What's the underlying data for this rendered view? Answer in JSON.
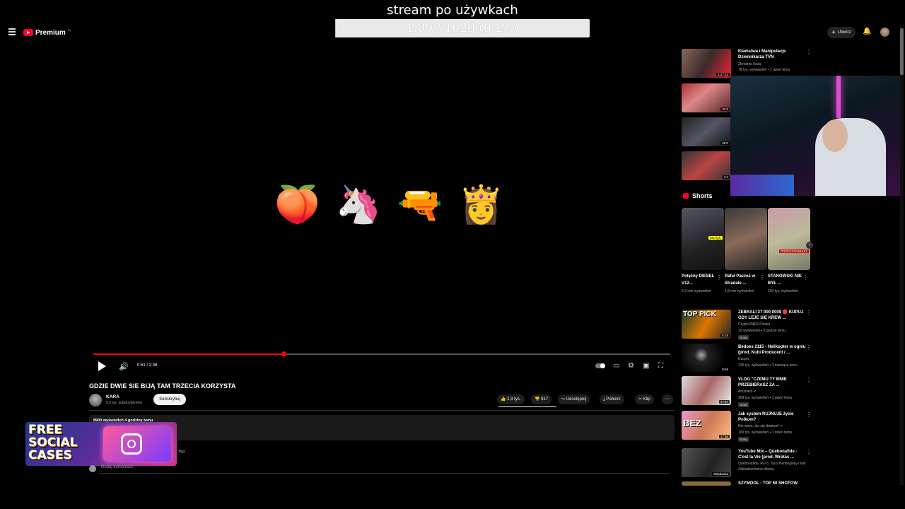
{
  "stream": {
    "title": "stream po używkach",
    "progress_text": "1.00 / 1020 (0.1%)",
    "progress_fraction": 0.001
  },
  "header": {
    "logo_text": "Premium",
    "logo_sup": "PL",
    "create_label": "Utwórz"
  },
  "player": {
    "emojis": [
      "🍑",
      "🦄",
      "🔫",
      "👸"
    ],
    "time": "0:51 / 2:36",
    "progress_fraction": 0.33
  },
  "video": {
    "title": "GDZIE DWIE SIE BIJĄ TAM TRZECIA KORZYSTA",
    "channel": "KARA",
    "subscribers": "5,5 tys. subskrybentów",
    "subscribe_label": "Subskrybuj",
    "likes": "2,3 tys.",
    "dislikes": "917",
    "share_label": "Udostępnij",
    "download_label": "Pobierz",
    "clip_label": "Klip",
    "description_meta": "8900 wyświetleń  4 godziny temu",
    "add_comment": "Dodaj komentarz",
    "partial_label": "flug"
  },
  "ad": {
    "line1": "FREE",
    "line2": "SOCIAL",
    "line3": "CASES"
  },
  "sidebar": {
    "top": {
      "title": "Kłamstwa i Manipulacje Dziennikarza TVN",
      "channel": "Zbrodnie Ikara",
      "meta": "78 tys. wyświetleń • 1 dzień temu",
      "duration": "1:27:23"
    },
    "thumb_durations": [
      "32:0",
      "36:0",
      "1:4"
    ],
    "shorts_label": "Shorts",
    "shorts": [
      {
        "title": "Potężny DIESEL V12...",
        "meta": "2,3 mln wyświetleń",
        "overlay": "900 tyś."
      },
      {
        "title": "Rafał Pacześ w Stradale ...",
        "meta": "1,8 mln wyświetleń",
        "overlay": ""
      },
      {
        "title": "STANOWSKI NIE BYŁ ...",
        "meta": "293 tys. wyświetleń",
        "overlay": "PRZEDSTAWIASZ"
      }
    ],
    "items": [
      {
        "title": "ZEBRALI 27 000 000$ 🔴 KUPUJ GDY LEJE SIĘ KREW ...",
        "channel": "CryptoONES Polska",
        "meta": "19 wyświetleń • 9 godzin temu",
        "badge": "Nowy",
        "duration": "5:19",
        "thumb_text": "TOP PICK"
      },
      {
        "title": "Bedoes 2115 - Helikopter w ogniu (prod. Kubi Producent / ...",
        "channel": "Kacper",
        "meta": "135 tys. wyświetleń • 3 miesiące temu",
        "badge": "",
        "duration": "8:56",
        "thumb_text": ""
      },
      {
        "title": "VLOG \"CZEMU TY MNIE PRZEBIERASZ ZA ...",
        "channel": "Andziaks ✔",
        "meta": "309 tys. wyświetleń • 1 dzień temu",
        "badge": "Nowy",
        "duration": "17:57",
        "thumb_text": ""
      },
      {
        "title": "Jak system RUJNUJE życie Polkom?",
        "channel": "Nie wiem, ale się dowiem! ✔",
        "meta": "100 tys. wyświetleń • 1 dzień temu",
        "badge": "Nowy",
        "duration": "17:56",
        "thumb_text": "BEZ"
      },
      {
        "title": "YouTube Mix – Quebonafide - C'est la Vie (prod. Wrotas ...",
        "channel": "Quebonafide, ReTo, Taco Hemingway i inni",
        "meta": "Zaktualizowano dzisiaj",
        "badge": "",
        "duration": "Składanka",
        "thumb_text": ""
      }
    ],
    "last_partial": "SZYMOOL - TOP 50 SHOTÓW"
  },
  "colors": {
    "accent": "#ff0000",
    "brand": "#ff0033"
  }
}
